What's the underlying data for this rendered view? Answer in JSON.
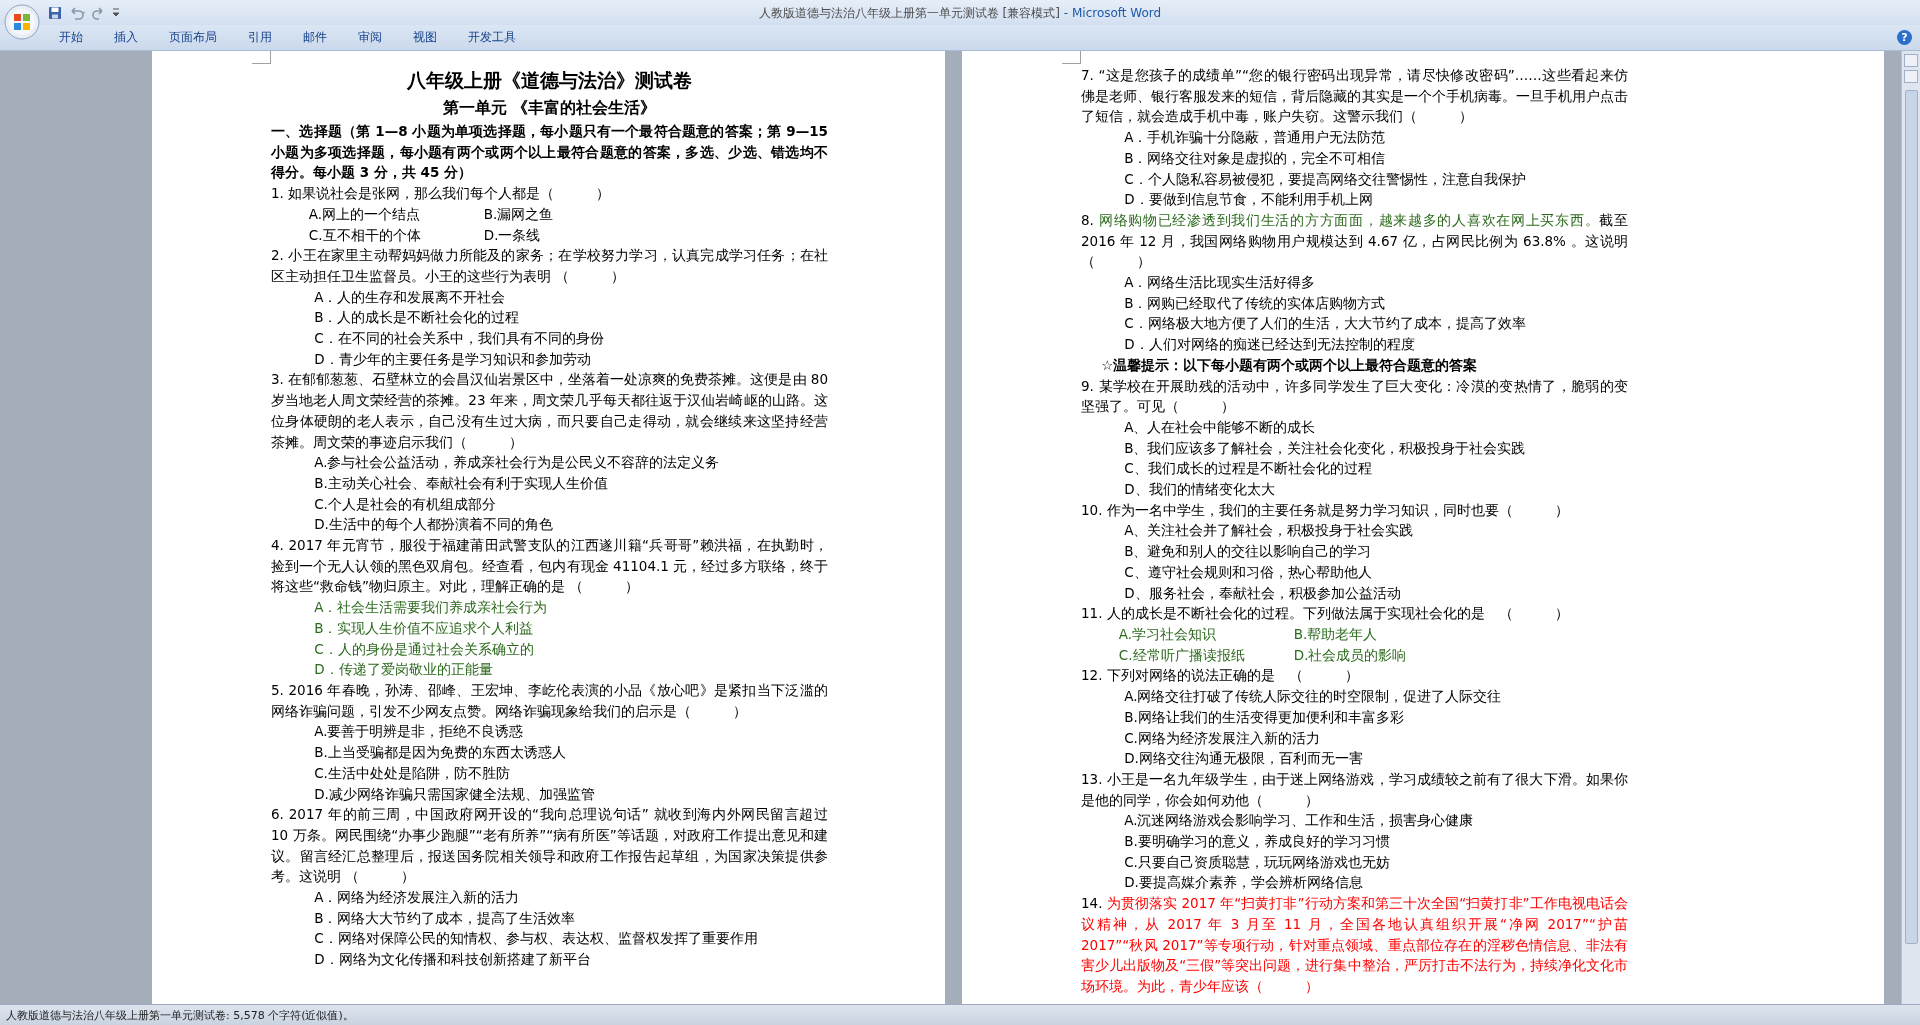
{
  "window": {
    "title": "人教版道德与法治八年级上册第一单元测试卷 [兼容模式]",
    "app": "- Microsoft Word"
  },
  "ribbon": {
    "tabs": [
      "开始",
      "插入",
      "页面布局",
      "引用",
      "邮件",
      "审阅",
      "视图",
      "开发工具"
    ],
    "help": "?"
  },
  "pages": [
    {
      "blocks": [
        {
          "kind": "title",
          "text": "八年级上册《道德与法治》测试卷"
        },
        {
          "kind": "subtitle",
          "text": "第一单元 《丰富的社会生活》"
        },
        {
          "kind": "instructions",
          "text": "一、选择题（第 1—8 小题为单项选择题，每小题只有一个最符合题意的答案；第 9—15 小题为多项选择题，每小题有两个或两个以上最符合题意的答案，多选、少选、错选均不得分。每小题 3 分，共 45 分）"
        },
        {
          "kind": "question",
          "number": "1.",
          "stem": [
            {
              "text": "如果说社会是张网，那么我们每个人都是（　　　）"
            }
          ],
          "option_rows": [
            [
              {
                "text": "A.网上的一个结点"
              },
              {
                "text": "B.漏网之鱼"
              }
            ],
            [
              {
                "text": "C.互不相干的个体"
              },
              {
                "text": "D.一条线"
              }
            ]
          ]
        },
        {
          "kind": "question",
          "number": "2.",
          "stem": [
            {
              "text": "小王在家里主动帮妈妈做力所能及的家务；在学校努力学习，认真完成学习任务；在社区主动担任卫生监督员。小王的这些行为表明 （　　　）"
            }
          ],
          "options": [
            {
              "text": "A．人的生存和发展离不开社会"
            },
            {
              "text": "B．人的成长是不断社会化的过程"
            },
            {
              "text": "C．在不同的社会关系中，我们具有不同的身份"
            },
            {
              "text": "D．青少年的主要任务是学习知识和参加劳动"
            }
          ]
        },
        {
          "kind": "question",
          "number": "3.",
          "stem": [
            {
              "text": "在郁郁葱葱、石壁林立的会昌汉仙岩景区中，坐落着一处凉爽的免费茶摊。这便是由 80 岁当地老人周文荣经营的茶摊。23 年来，周文荣几乎每天都往返于汉仙岩崎岖的山路。这位身体硬朗的老人表示，自己没有生过大病，而只要自己走得动，就会继续来这坚持经营茶摊。周文荣的事迹启示我们（　　　）"
            }
          ],
          "options": [
            {
              "text": "A.参与社会公益活动，养成亲社会行为是公民义不容辞的法定义务"
            },
            {
              "text": "B.主动关心社会、奉献社会有利于实现人生价值"
            },
            {
              "text": "C.个人是社会的有机组成部分"
            },
            {
              "text": "D.生活中的每个人都扮演着不同的角色"
            }
          ]
        },
        {
          "kind": "question",
          "number": "4.",
          "stem": [
            {
              "text": "2017 年元宵节，服役于福建莆田武警支队的江西遂川籍“兵哥哥”赖洪福，在执勤时，捡到一个无人认领的黑色双肩包。经查看，包内有现金 41104.1 元，经过多方联络，终于将这些“救命钱”物归原主。对此，理解正确的是 （　　　）"
            }
          ],
          "options": [
            {
              "text": "A．社会生活需要我们养成亲社会行为",
              "color": "#2d6a1e"
            },
            {
              "text": "B．实现人生价值不应追求个人利益",
              "color": "#2d6a1e"
            },
            {
              "text": "C．人的身份是通过社会关系确立的",
              "color": "#2d6a1e"
            },
            {
              "text": "D．传递了爱岗敬业的正能量",
              "color": "#2d6a1e"
            }
          ]
        },
        {
          "kind": "question",
          "number": "5.",
          "stem": [
            {
              "text": "2016 年春晚，孙涛、邵峰、王宏坤、李屹伦表演的小品《放心吧》是紧扣当下泛滥的网络诈骗问题，引发不少网友点赞。网络诈骗现象给我们的启示是（　　　）"
            }
          ],
          "options": [
            {
              "text": "A.要善于明辨是非，拒绝不良诱惑"
            },
            {
              "text": "B.上当受骗都是因为免费的东西太诱惑人"
            },
            {
              "text": "C.生活中处处是陷阱，防不胜防"
            },
            {
              "text": "D.减少网络诈骗只需国家健全法规、加强监管"
            }
          ]
        },
        {
          "kind": "question",
          "number": "6.",
          "stem": [
            {
              "text": "2017 年的前三周，中国政府网开设的“我向总理说句话” 就收到海内外网民留言超过 10 万条。网民围绕“办事少跑腿”“老有所养”“病有所医”等话题，对政府工作提出意见和建议。留言经汇总整理后，报送国务院相关领导和政府工作报告起草组，为国家决策提供参考。这说明 （　　　）"
            }
          ],
          "options": [
            {
              "text": "A．网络为经济发展注入新的活力"
            },
            {
              "text": "B．网络大大节约了成本，提高了生活效率"
            },
            {
              "text": "C．网络对保障公民的知情权、参与权、表达权、监督权发挥了重要作用"
            },
            {
              "text": "D．网络为文化传播和科技创新搭建了新平台"
            }
          ]
        }
      ]
    },
    {
      "blocks": [
        {
          "kind": "question",
          "number": "7.",
          "stem": [
            {
              "text": "“这是您孩子的成绩单”“您的银行密码出现异常，请尽快修改密码”……这些看起来仿佛是老师、银行客服发来的短信，背后隐藏的其实是一个个手机病毒。一旦手机用户点击了短信，就会造成手机中毒，账户失窃。这警示我们（　　　）"
            }
          ],
          "options": [
            {
              "text": "A．手机诈骗十分隐蔽，普通用户无法防范"
            },
            {
              "text": "B．网络交往对象是虚拟的，完全不可相信"
            },
            {
              "text": "C．个人隐私容易被侵犯，要提高网络交往警惕性，注意自我保护"
            },
            {
              "text": "D．要做到信息节食，不能利用手机上网"
            }
          ]
        },
        {
          "kind": "question",
          "number": "8.",
          "stem": [
            {
              "text": "网络购物已经渗透到我们生活的方方面面，越来越多的人喜欢在网上买东西。",
              "color": "#2d6a1e"
            },
            {
              "text": "截至 2016 年 12 月，我国网络购物用户规模达到 4.67 亿，占网民比例为 63.8% 。这说明（　　　）"
            }
          ],
          "options": [
            {
              "text": "A．网络生活比现实生活好得多"
            },
            {
              "text": "B．网购已经取代了传统的实体店购物方式"
            },
            {
              "text": "C．网络极大地方便了人们的生活，大大节约了成本，提高了效率"
            },
            {
              "text": "D．人们对网络的痴迷已经达到无法控制的程度"
            }
          ]
        },
        {
          "kind": "tip",
          "text": "☆温馨提示：以下每小题有两个或两个以上最符合题意的答案"
        },
        {
          "kind": "question",
          "number": "9.",
          "stem": [
            {
              "text": "某学校在开展助残的活动中，许多同学发生了巨大变化：冷漠的变热情了，脆弱的变坚强了。可见（　　　）"
            }
          ],
          "options": [
            {
              "text": "A、人在社会中能够不断的成长"
            },
            {
              "text": "B、我们应该多了解社会，关注社会化变化，积极投身于社会实践"
            },
            {
              "text": "C、我们成长的过程是不断社会化的过程"
            },
            {
              "text": "D、我们的情绪变化太大"
            }
          ]
        },
        {
          "kind": "question",
          "number": "10.",
          "stem": [
            {
              "text": "作为一名中学生，我们的主要任务就是努力学习知识，同时也要（　　　）"
            }
          ],
          "options": [
            {
              "text": "A、关注社会并了解社会，积极投身于社会实践"
            },
            {
              "text": "B、避免和别人的交往以影响自己的学习"
            },
            {
              "text": "C、遵守社会规则和习俗，热心帮助他人"
            },
            {
              "text": "D、服务社会，奉献社会，积极参加公益活动"
            }
          ]
        },
        {
          "kind": "question",
          "number": "11.",
          "stem": [
            {
              "text": "人的成长是不断社会化的过程。下列做法属于实现社会化的是　（　　　）"
            }
          ],
          "option_rows": [
            [
              {
                "text": "A.学习社会知识",
                "color": "#2d6a1e"
              },
              {
                "text": "B.帮助老年人",
                "color": "#2d6a1e"
              }
            ],
            [
              {
                "text": "C.经常听广播读报纸",
                "color": "#2d6a1e"
              },
              {
                "text": "D.社会成员的影响",
                "color": "#2d6a1e"
              }
            ]
          ]
        },
        {
          "kind": "question",
          "number": "12.",
          "stem": [
            {
              "text": "下列对网络的说法正确的是　（　　　）"
            }
          ],
          "options": [
            {
              "text": "A.网络交往打破了传统人际交往的时空限制，促进了人际交往"
            },
            {
              "text": "B.网络让我们的生活变得更加便利和丰富多彩"
            },
            {
              "text": "C.网络为经济发展注入新的活力"
            },
            {
              "text": "D.网络交往沟通无极限，百利而无一害"
            }
          ]
        },
        {
          "kind": "question",
          "number": "13.",
          "stem": [
            {
              "text": "小王是一名九年级学生，由于迷上网络游戏，学习成绩较之前有了很大下滑。如果你是他的同学，你会如何劝他（　　　）"
            }
          ],
          "options": [
            {
              "text": "A.沉迷网络游戏会影响学习、工作和生活，损害身心健康"
            },
            {
              "text": "B.要明确学习的意义，养成良好的学习习惯"
            },
            {
              "text": "C.只要自己资质聪慧，玩玩网络游戏也无妨"
            },
            {
              "text": "D.要提高媒介素养，学会辨析网络信息"
            }
          ]
        },
        {
          "kind": "question",
          "number": "14.",
          "stem": [
            {
              "text": "为贯彻落实 2017 年“扫黄打非”行动方案和第三十次全国“扫黄打非”工作电视电话会议精神，从 2017 年 3 月至 11 月，全国各地认真组织开展“净网 2017”“护苗 2017”“秋风 2017”等专项行动，针对重点领域、重点部位存在的淫秽色情信息、非法有害少儿出版物及“三假”等突出问题，进行集中整治，严厉打击不法行为，持续净化文化市场环境。为此，青少年应该（　　　）",
              "color": "#ff0000"
            }
          ]
        }
      ]
    }
  ],
  "status_bar": {
    "text": "人教版道德与法治八年级上册第一单元测试卷: 5,578 个字符(近似值)。"
  }
}
